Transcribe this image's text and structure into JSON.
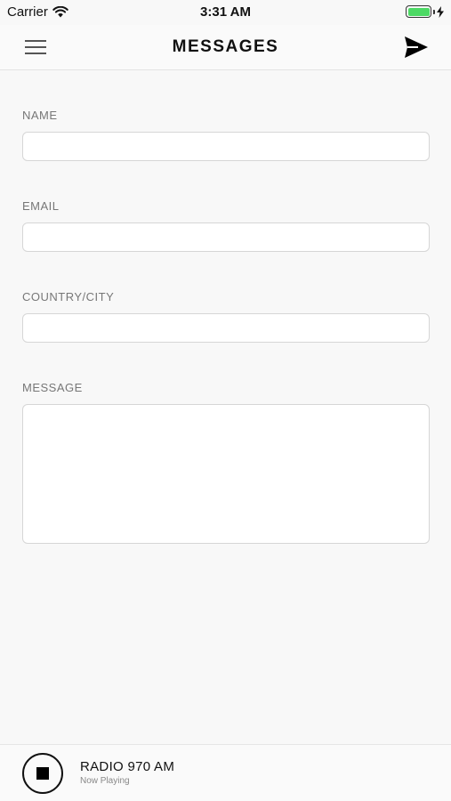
{
  "status_bar": {
    "carrier": "Carrier",
    "time": "3:31 AM",
    "battery_color": "#4cd964"
  },
  "nav": {
    "title": "MESSAGES",
    "menu_icon": "hamburger-icon",
    "send_icon": "paper-plane-icon"
  },
  "form": {
    "name_label": "NAME",
    "name_value": "",
    "email_label": "EMAIL",
    "email_value": "",
    "country_label": "COUNTRY/CITY",
    "country_value": "",
    "message_label": "MESSAGE",
    "message_value": ""
  },
  "player": {
    "station": "RADIO 970 AM",
    "status": "Now Playing",
    "control_icon": "stop-icon"
  }
}
